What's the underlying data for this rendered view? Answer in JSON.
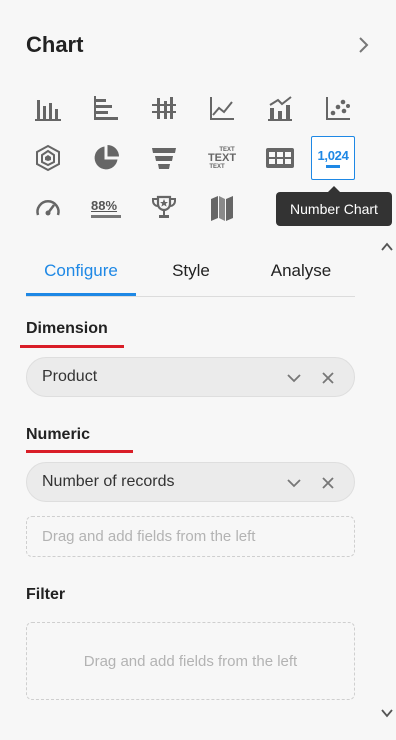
{
  "header": {
    "title": "Chart"
  },
  "chart_types": [
    {
      "name": "bar-chart-icon"
    },
    {
      "name": "horizontal-bar-chart-icon"
    },
    {
      "name": "stacked-bar-chart-icon"
    },
    {
      "name": "line-chart-icon"
    },
    {
      "name": "combo-chart-icon"
    },
    {
      "name": "scatter-chart-icon"
    },
    {
      "name": "radar-chart-icon"
    },
    {
      "name": "pie-chart-icon"
    },
    {
      "name": "funnel-chart-icon"
    },
    {
      "name": "word-cloud-icon",
      "small_text": "TEXT",
      "big_text": "TEXT"
    },
    {
      "name": "table-chart-icon"
    },
    {
      "name": "number-chart-icon",
      "value_text": "1,024",
      "selected": true
    },
    {
      "name": "gauge-chart-icon"
    },
    {
      "name": "progress-chart-icon",
      "value_text": "88%"
    },
    {
      "name": "ranking-chart-icon"
    },
    {
      "name": "map-chart-icon"
    }
  ],
  "tooltip": {
    "text": "Number Chart"
  },
  "tabs": [
    {
      "label": "Configure",
      "active": true
    },
    {
      "label": "Style",
      "active": false
    },
    {
      "label": "Analyse",
      "active": false
    }
  ],
  "sections": {
    "dimension": {
      "title": "Dimension",
      "field": "Product"
    },
    "numeric": {
      "title": "Numeric",
      "field": "Number of records",
      "dropzone": "Drag and add fields from the left"
    },
    "filter": {
      "title": "Filter",
      "dropzone": "Drag and add fields from the left"
    }
  },
  "colors": {
    "accent": "#1e88e5",
    "required_underline": "#d91e27",
    "icon": "#666666"
  }
}
